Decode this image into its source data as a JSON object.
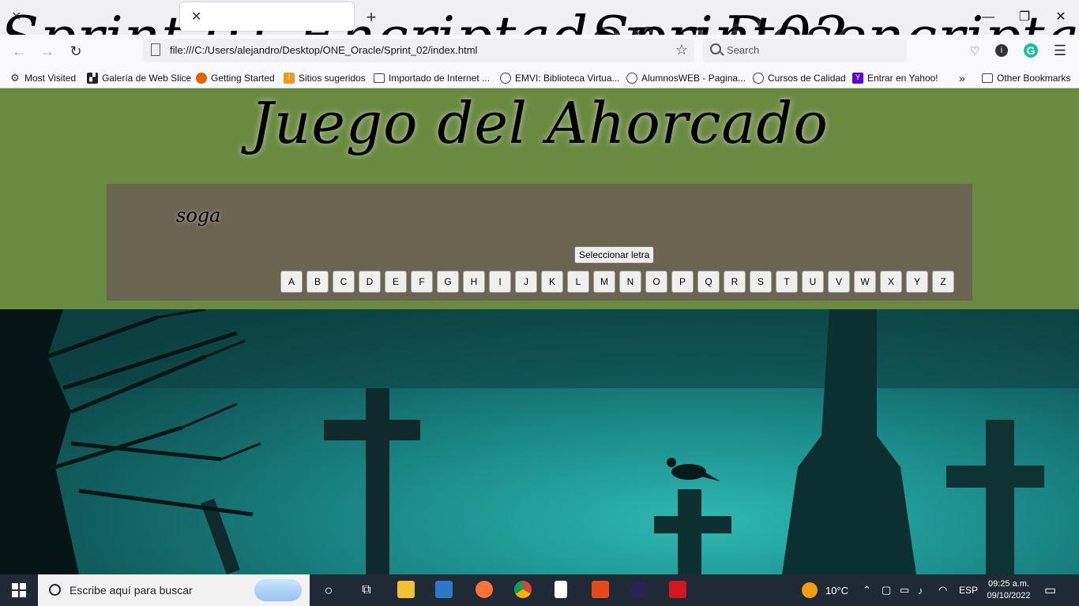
{
  "browser": {
    "tabs": [
      {
        "title": "Sprint 01 Encriptador y Desencriptador",
        "active": false
      },
      {
        "title": "Sprint02",
        "active": true
      }
    ],
    "url": "file:///C:/Users/alejandro/Desktop/ONE_Oracle/Sprint_02/index.html",
    "search_placeholder": "Search",
    "bookmarks": [
      {
        "label": "Most Visited",
        "icon": "gear-icon"
      },
      {
        "label": "Galería de Web Slice",
        "icon": "webslice-icon"
      },
      {
        "label": "Getting Started",
        "icon": "firefox-icon"
      },
      {
        "label": "Sitios sugeridos",
        "icon": "suggested-icon"
      },
      {
        "label": "Importado de Internet ...",
        "icon": "folder-icon"
      },
      {
        "label": "EMVI: Biblioteca Virtua...",
        "icon": "globe-icon"
      },
      {
        "label": "AlumnosWEB - Pagina...",
        "icon": "globe-icon"
      },
      {
        "label": "Cursos de Calidad",
        "icon": "globe-icon"
      },
      {
        "label": "Entrar en Yahoo!",
        "icon": "yahoo-icon"
      }
    ],
    "other_bookmarks": "Other Bookmarks"
  },
  "game": {
    "title": "Juego del Ahorcado",
    "word": "soga",
    "select_button": "Seleccionar letra",
    "letters": [
      "A",
      "B",
      "C",
      "D",
      "E",
      "F",
      "G",
      "H",
      "I",
      "J",
      "K",
      "L",
      "M",
      "N",
      "O",
      "P",
      "Q",
      "R",
      "S",
      "T",
      "U",
      "V",
      "W",
      "X",
      "Y",
      "Z"
    ]
  },
  "taskbar": {
    "search_placeholder": "Escribe aquí para buscar",
    "weather": "10°C",
    "language": "ESP",
    "time": "09:25 a.m.",
    "date": "09/10/2022"
  },
  "colors": {
    "header_green": "#6a8a40",
    "gamebox": "#6a6550",
    "taskbar": "#1f2a36"
  }
}
